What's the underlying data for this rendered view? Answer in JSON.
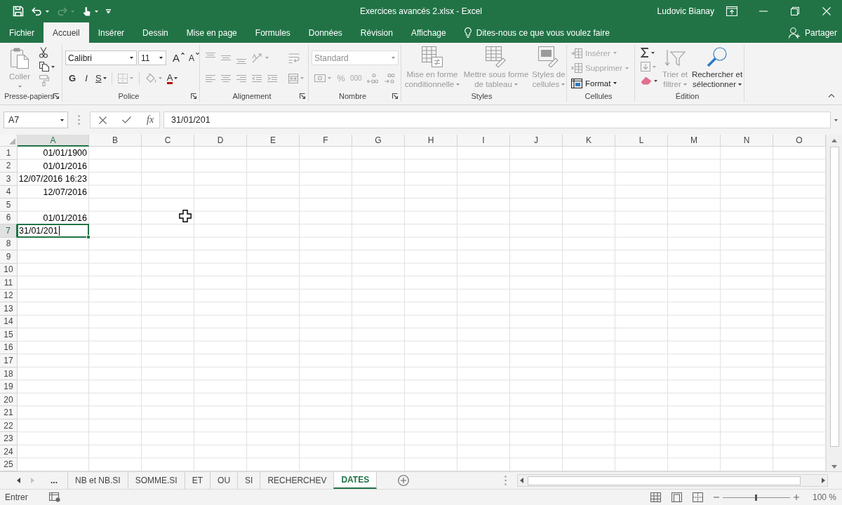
{
  "window": {
    "title": "Exercices avancés 2.xlsx - Excel",
    "user": "Ludovic Bianay"
  },
  "quick_access": [
    {
      "kind": "save",
      "disabled": false
    },
    {
      "kind": "undo",
      "disabled": false
    },
    {
      "kind": "redo",
      "disabled": true
    },
    {
      "kind": "touch",
      "disabled": false
    },
    {
      "kind": "customize",
      "disabled": false
    }
  ],
  "ribbon_tabs": [
    {
      "label": "Fichier",
      "selected": false
    },
    {
      "label": "Accueil",
      "selected": true
    },
    {
      "label": "Insérer",
      "selected": false
    },
    {
      "label": "Dessin",
      "selected": false
    },
    {
      "label": "Mise en page",
      "selected": false
    },
    {
      "label": "Formules",
      "selected": false
    },
    {
      "label": "Données",
      "selected": false
    },
    {
      "label": "Révision",
      "selected": false
    },
    {
      "label": "Affichage",
      "selected": false
    }
  ],
  "tell_me": {
    "label": "Dites-nous ce que vous voulez faire"
  },
  "share": {
    "label": "Partager"
  },
  "ribbon": {
    "groups": [
      {
        "kind": "clipboard",
        "label": "Presse-papiers",
        "launcher": true,
        "controls": [
          {
            "kind": "paste",
            "label": "Coller",
            "disabled": true
          },
          {
            "kind": "cut",
            "disabled": false
          },
          {
            "kind": "copy",
            "disabled": false
          },
          {
            "kind": "painter",
            "disabled": true
          }
        ]
      },
      {
        "kind": "font",
        "label": "Police",
        "launcher": true,
        "controls": [
          {
            "kind": "fontname",
            "value": "Calibri",
            "disabled": false
          },
          {
            "kind": "fontsize",
            "value": "11",
            "disabled": false
          },
          {
            "kind": "grow",
            "label": "A",
            "disabled": false
          },
          {
            "kind": "shrink",
            "label": "A",
            "disabled": false
          },
          {
            "kind": "bold",
            "label": "G",
            "disabled": false
          },
          {
            "kind": "italic",
            "label": "I",
            "disabled": false
          },
          {
            "kind": "underline",
            "label": "S",
            "disabled": false
          },
          {
            "kind": "borders",
            "disabled": true
          },
          {
            "kind": "shading",
            "disabled": true
          },
          {
            "kind": "fontcolor",
            "label": "A",
            "disabled": false
          }
        ]
      },
      {
        "kind": "alignment",
        "label": "Alignement",
        "launcher": true,
        "controls": [
          {
            "kind": "top",
            "disabled": true
          },
          {
            "kind": "middle",
            "disabled": true
          },
          {
            "kind": "bottom",
            "disabled": true
          },
          {
            "kind": "orientation",
            "disabled": true
          },
          {
            "kind": "wrap",
            "disabled": true
          },
          {
            "kind": "left",
            "disabled": true
          },
          {
            "kind": "center",
            "disabled": true
          },
          {
            "kind": "right",
            "disabled": true
          },
          {
            "kind": "outdent",
            "disabled": true
          },
          {
            "kind": "indent",
            "disabled": true
          },
          {
            "kind": "merge",
            "disabled": true
          }
        ]
      },
      {
        "kind": "number",
        "label": "Nombre",
        "launcher": true,
        "controls": [
          {
            "kind": "numformat",
            "value": "Standard",
            "disabled": true
          },
          {
            "kind": "accounting",
            "disabled": true
          },
          {
            "kind": "percent",
            "label": "%",
            "disabled": true
          },
          {
            "kind": "thousands",
            "label": "000",
            "disabled": true
          },
          {
            "kind": "moredecimals",
            "disabled": true
          },
          {
            "kind": "fewerdecimals",
            "disabled": true
          }
        ]
      },
      {
        "kind": "styles",
        "label": "Styles",
        "launcher": false,
        "controls": [
          {
            "kind": "conditional",
            "label": "Mise en forme conditionnelle",
            "disabled": true
          },
          {
            "kind": "table",
            "label": "Mettre sous forme de tableau",
            "disabled": true
          },
          {
            "kind": "cellstyles",
            "label": "Styles de cellules",
            "disabled": true
          }
        ]
      },
      {
        "kind": "cells",
        "label": "Cellules",
        "launcher": false,
        "controls": [
          {
            "kind": "insert",
            "label": "Insérer",
            "disabled": true
          },
          {
            "kind": "delete",
            "label": "Supprimer",
            "disabled": true
          },
          {
            "kind": "format",
            "label": "Format",
            "disabled": false
          }
        ]
      },
      {
        "kind": "editing",
        "label": "Édition",
        "launcher": false,
        "controls": [
          {
            "kind": "autosum",
            "disabled": false
          },
          {
            "kind": "filldown",
            "disabled": true
          },
          {
            "kind": "clear",
            "disabled": false
          },
          {
            "kind": "sort",
            "label": "Trier et filtrer",
            "disabled": true
          },
          {
            "kind": "find",
            "label": "Rechercher et sélectionner",
            "disabled": false
          }
        ]
      }
    ]
  },
  "formula_bar": {
    "name_box": "A7",
    "function_label": "fx",
    "formula": "31/01/201"
  },
  "sheet": {
    "columns": [
      {
        "label": "A",
        "selected": true
      },
      {
        "label": "B",
        "selected": false
      },
      {
        "label": "C",
        "selected": false
      },
      {
        "label": "D",
        "selected": false
      },
      {
        "label": "E",
        "selected": false
      },
      {
        "label": "F",
        "selected": false
      },
      {
        "label": "G",
        "selected": false
      },
      {
        "label": "H",
        "selected": false
      },
      {
        "label": "I",
        "selected": false
      },
      {
        "label": "J",
        "selected": false
      },
      {
        "label": "K",
        "selected": false
      },
      {
        "label": "L",
        "selected": false
      },
      {
        "label": "M",
        "selected": false
      },
      {
        "label": "N",
        "selected": false
      },
      {
        "label": "O",
        "selected": false
      }
    ],
    "rows": [
      {
        "label": "1",
        "selected": false,
        "cells": [
          {
            "text": "01/01/1900",
            "selected": false
          }
        ]
      },
      {
        "label": "2",
        "selected": false,
        "cells": [
          {
            "text": "01/01/2016",
            "selected": false
          }
        ]
      },
      {
        "label": "3",
        "selected": false,
        "cells": [
          {
            "text": "12/07/2016 16:23",
            "selected": false
          }
        ]
      },
      {
        "label": "4",
        "selected": false,
        "cells": [
          {
            "text": "12/07/2016",
            "selected": false
          }
        ]
      },
      {
        "label": "5",
        "selected": false
      },
      {
        "label": "6",
        "selected": false,
        "cells": [
          {
            "text": "01/01/2016",
            "selected": false
          }
        ]
      },
      {
        "label": "7",
        "selected": true,
        "cells": [
          {
            "text": "31/01/201",
            "selected": true
          }
        ]
      },
      {
        "label": "8",
        "selected": false
      },
      {
        "label": "9",
        "selected": false
      },
      {
        "label": "10",
        "selected": false
      },
      {
        "label": "11",
        "selected": false
      },
      {
        "label": "12",
        "selected": false
      },
      {
        "label": "13",
        "selected": false
      },
      {
        "label": "14",
        "selected": false
      },
      {
        "label": "15",
        "selected": false
      },
      {
        "label": "16",
        "selected": false
      },
      {
        "label": "17",
        "selected": false
      },
      {
        "label": "18",
        "selected": false
      },
      {
        "label": "19",
        "selected": false
      },
      {
        "label": "20",
        "selected": false
      },
      {
        "label": "21",
        "selected": false
      },
      {
        "label": "22",
        "selected": false
      },
      {
        "label": "23",
        "selected": false
      },
      {
        "label": "24",
        "selected": false
      },
      {
        "label": "25",
        "selected": false
      }
    ]
  },
  "sheet_tabs": {
    "nav": [
      {
        "kind": "prev",
        "disabled": false
      },
      {
        "kind": "next",
        "disabled": true
      }
    ],
    "overflow": "...",
    "tabs": [
      {
        "label": "NB et NB.SI",
        "selected": false
      },
      {
        "label": "SOMME.SI",
        "selected": false
      },
      {
        "label": "ET",
        "selected": false
      },
      {
        "label": "OU",
        "selected": false
      },
      {
        "label": "SI",
        "selected": false
      },
      {
        "label": "RECHERCHEV",
        "selected": false
      },
      {
        "label": "DATES",
        "selected": true
      }
    ]
  },
  "status_bar": {
    "mode": "Entrer",
    "zoom_slider": {
      "level": 0.5
    },
    "zoom": "100 %"
  }
}
